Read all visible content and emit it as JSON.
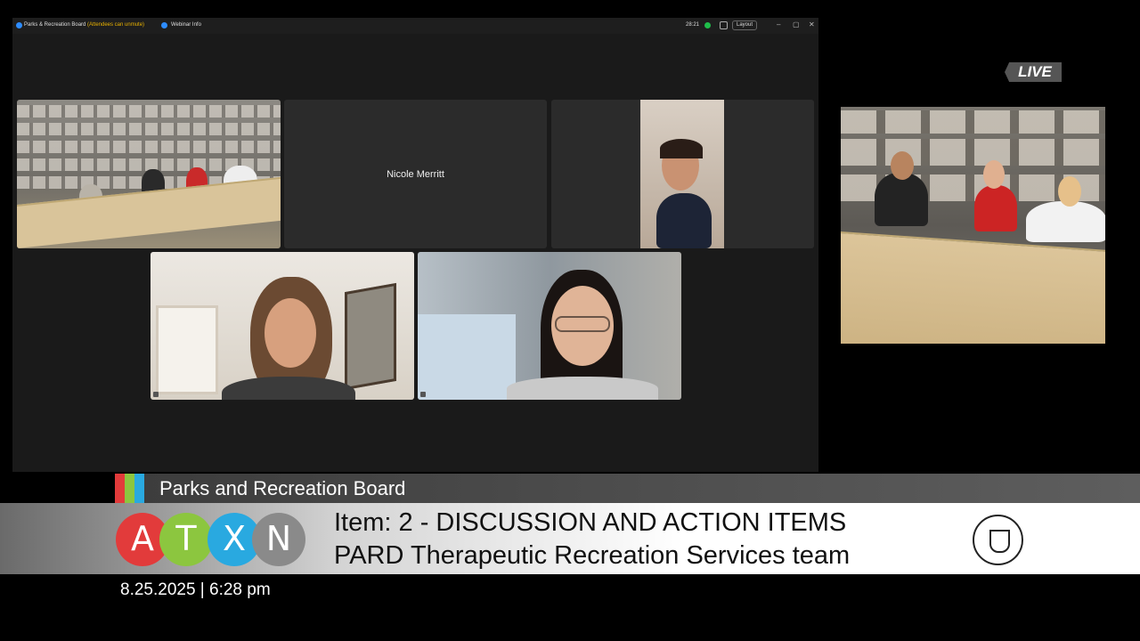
{
  "zoom": {
    "meeting_title": "Parks & Recreation Board",
    "unmute_note": "(Attendees can unmute)",
    "webinar_info": "Webinar Info",
    "clock": "28:21",
    "layout_label": "Layout",
    "min_glyph": "–",
    "max_glyph": "▢",
    "close_glyph": "✕"
  },
  "participants": [
    {
      "name": "Nicole Merritt",
      "video": false
    }
  ],
  "live_label": "LIVE",
  "lower_third": {
    "board_name": "Parks and Recreation Board",
    "item_line1": "Item: 2 - DISCUSSION AND ACTION ITEMS",
    "item_line2": "PARD Therapeutic Recreation Services team",
    "logo_letters": [
      "A",
      "T",
      "X",
      "N"
    ],
    "datetime": "8.25.2025 | 6:28 pm"
  },
  "colors": {
    "atxn_red": "#e23b3b",
    "atxn_green": "#8cc63f",
    "atxn_blue": "#29a9e0",
    "atxn_gray": "#8a8a8a"
  }
}
